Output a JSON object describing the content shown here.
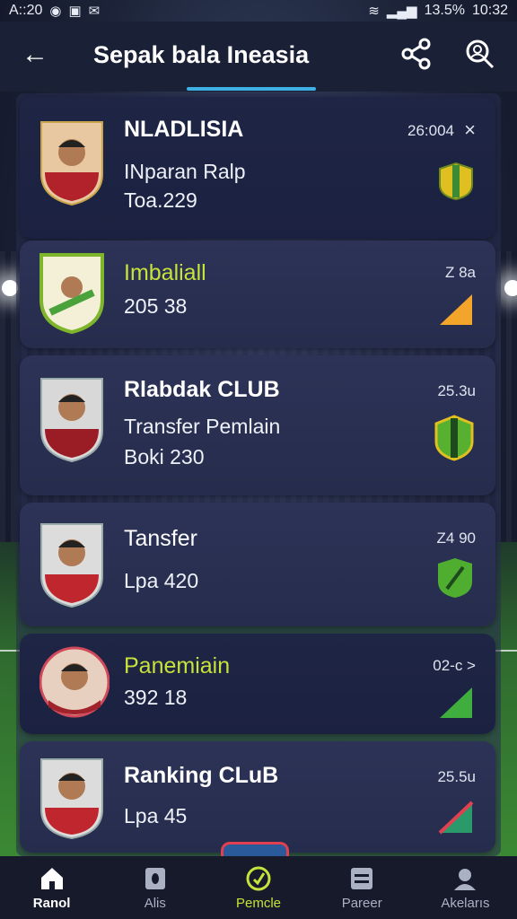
{
  "status": {
    "time": "A::20",
    "battery": "13.5%",
    "clock": "10:32"
  },
  "header": {
    "title": "Sepak bala Ineasia"
  },
  "cards": [
    {
      "name": "NLADLISIA",
      "line2": "INparan Ralp",
      "line3": "Toa.229",
      "meta": "26:004",
      "close": "×",
      "badge_color": "#e0c020"
    },
    {
      "name": "Imbaliall",
      "line2": "205 38",
      "line3": "",
      "meta": "Z 8a",
      "badge_color": "#f2a52a"
    },
    {
      "name": "Rlabdak CLUB",
      "line2": "Transfer Pemlain",
      "line3": "Boki 230",
      "meta": "25.3u",
      "badge_color": "#58b030"
    },
    {
      "name": "Tansfer",
      "line2": "Lpa 420",
      "line3": "",
      "meta": "Z4 90",
      "badge_color": "#4fae2f"
    },
    {
      "name": "Panemiain",
      "line2": "392 18",
      "line3": "",
      "meta": "02-с >",
      "badge_color": "#3fae3f"
    },
    {
      "name": "Ranking CLuB",
      "line2": "Lpa 45",
      "line3": "",
      "meta": "25.5u",
      "badge_color": "#2a9a6a"
    }
  ],
  "nav": [
    {
      "label": "Ranol",
      "icon": "home-icon"
    },
    {
      "label": "Alis",
      "icon": "badge-icon"
    },
    {
      "label": "Pemcle",
      "icon": "check-circle-icon"
    },
    {
      "label": "Pareer",
      "icon": "list-icon"
    },
    {
      "label": "Akelarıs",
      "icon": "user-icon"
    }
  ]
}
